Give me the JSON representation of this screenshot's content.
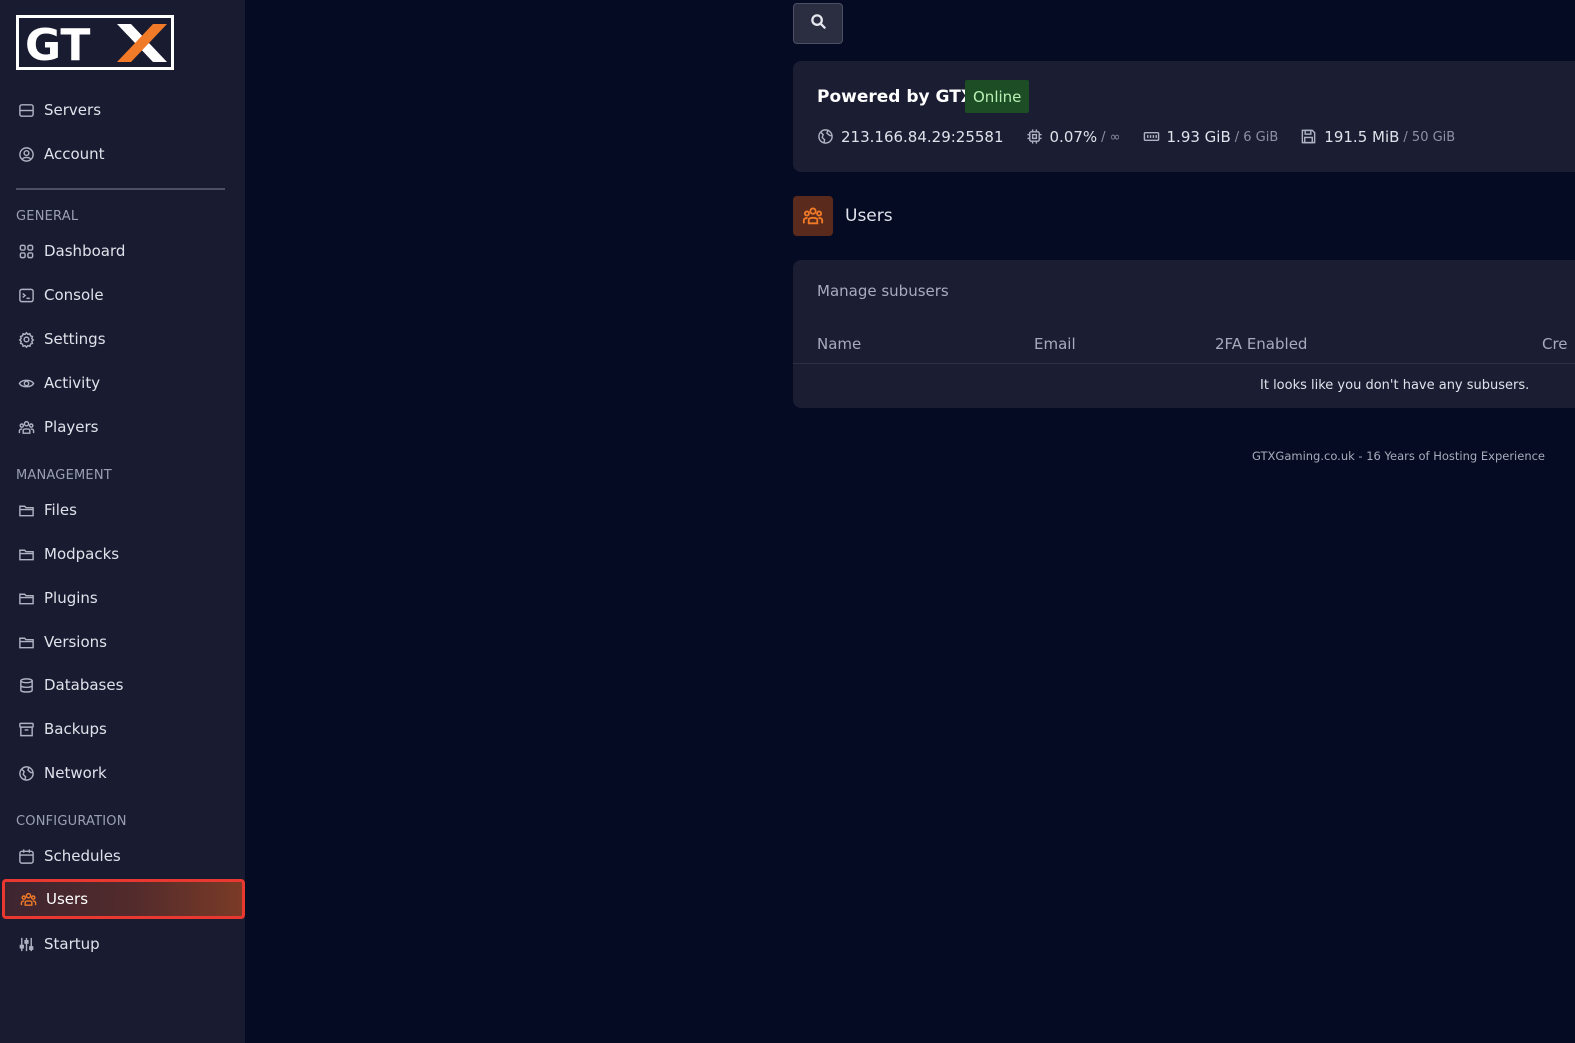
{
  "brand": {
    "logo_text": "GTX"
  },
  "sidebar": {
    "top_items": [
      {
        "label": "Servers",
        "icon": "servers-icon"
      },
      {
        "label": "Account",
        "icon": "user-circle-icon"
      }
    ],
    "sections": [
      {
        "title": "GENERAL"
      },
      {
        "title": "MANAGEMENT"
      },
      {
        "title": "CONFIGURATION"
      }
    ],
    "general_items": [
      {
        "label": "Dashboard",
        "icon": "grid-icon"
      },
      {
        "label": "Console",
        "icon": "terminal-icon"
      },
      {
        "label": "Settings",
        "icon": "gear-icon"
      },
      {
        "label": "Activity",
        "icon": "eye-icon"
      },
      {
        "label": "Players",
        "icon": "users-group-icon"
      }
    ],
    "management_items": [
      {
        "label": "Files",
        "icon": "folder-icon"
      },
      {
        "label": "Modpacks",
        "icon": "folder-icon"
      },
      {
        "label": "Plugins",
        "icon": "folder-icon"
      },
      {
        "label": "Versions",
        "icon": "folder-icon"
      },
      {
        "label": "Databases",
        "icon": "database-icon"
      },
      {
        "label": "Backups",
        "icon": "archive-icon"
      },
      {
        "label": "Network",
        "icon": "globe-icon"
      }
    ],
    "configuration_items": [
      {
        "label": "Schedules",
        "icon": "calendar-icon"
      },
      {
        "label": "Users",
        "icon": "users-group-icon",
        "active": true
      },
      {
        "label": "Startup",
        "icon": "sliders-icon"
      }
    ]
  },
  "server": {
    "name": "Powered by GTX",
    "status": "Online",
    "address": "213.166.84.29:25581",
    "cpu": {
      "value": "0.07%",
      "limit": "/ ∞"
    },
    "memory": {
      "value": "1.93 GiB",
      "limit": "/ 6 GiB"
    },
    "disk": {
      "value": "191.5 MiB",
      "limit": "/ 50 GiB"
    }
  },
  "page": {
    "title": "Users",
    "card_subtitle": "Manage subusers",
    "columns": [
      "Name",
      "Email",
      "2FA Enabled",
      "Cre"
    ],
    "empty_message": "It looks like you don't have any subusers."
  },
  "footer": {
    "text": "GTXGaming.co.uk - 16 Years of Hosting Experience"
  },
  "colors": {
    "background": "#050b22",
    "sidebar": "#191b31",
    "card": "#1b1d33",
    "accent": "#f07a28",
    "active_border": "#e8382f",
    "online_bg": "#1d4d25"
  }
}
